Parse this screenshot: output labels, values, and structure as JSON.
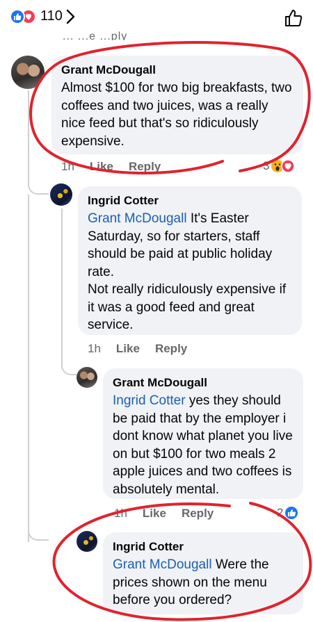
{
  "header": {
    "reaction_count": "110"
  },
  "truncated_text": "... ...e  ...ply",
  "comments": [
    {
      "name": "Grant McDougall",
      "mention": "",
      "text": "Almost $100 for two big breakfasts, two coffees and two juices, was a really nice feed but that's so ridiculously expensive.",
      "time": "1h",
      "like": "Like",
      "reply": "Reply",
      "reactions": "3"
    },
    {
      "name": "Ingrid Cotter",
      "mention": "Grant McDougall",
      "text": " It's Easter Saturday, so for starters, staff should be paid at public holiday rate.\nNot really ridiculously expensive if it was a good feed and great service.",
      "time": "1h",
      "like": "Like",
      "reply": "Reply"
    },
    {
      "name": "Grant McDougall",
      "mention": "Ingrid Cotter",
      "text": " yes they should be paid that by the employer i dont know what planet you live on but $100 for two meals 2 apple juices and two coffees is absolutely mental.",
      "time": "1h",
      "like": "Like",
      "reply": "Reply",
      "reactions": "2"
    },
    {
      "name": "Ingrid Cotter",
      "mention": "Grant McDougall",
      "text": " Were the prices shown on the menu before you ordered?"
    }
  ],
  "colors": {
    "annotation": "#e0232e",
    "link": "#1a5fb4",
    "bubble": "#f0f2f5"
  }
}
